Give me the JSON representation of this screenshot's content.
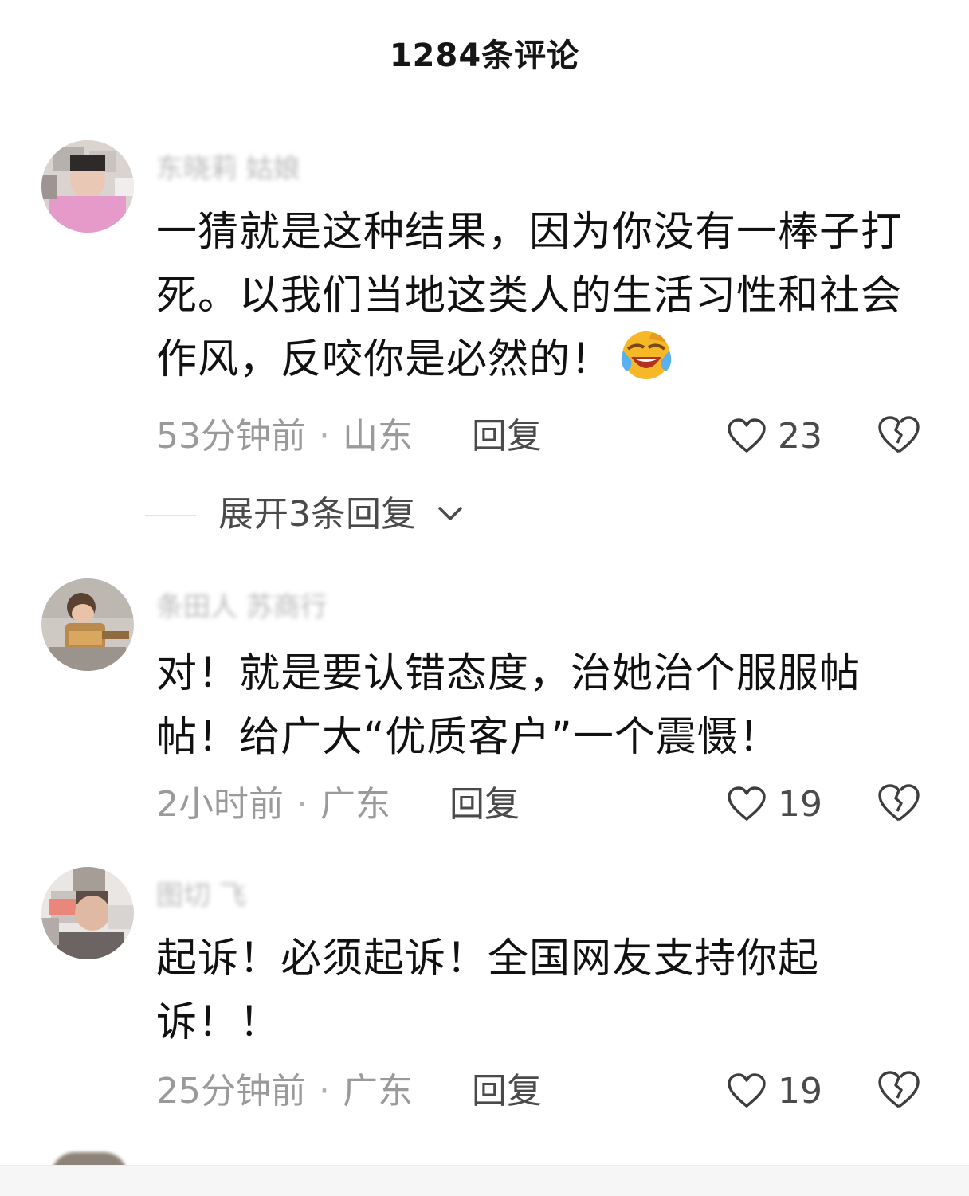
{
  "header": {
    "title": "1284条评论"
  },
  "comments": [
    {
      "username": "东晓莉 姑娘",
      "text": "一猜就是这种结果，因为你没有一棒子打死。以我们当地这类人的生活习性和社会作风，反咬你是必然的！",
      "emoji": "face-with-tears-of-joy",
      "time": "53分钟前",
      "separator": "·",
      "location": "山东",
      "reply": "回复",
      "likes": "23"
    },
    {
      "username": "条田人 苏商行",
      "text": "对！就是要认错态度，治她治个服服帖帖！给广大“优质客户”一个震慑！",
      "time": "2小时前",
      "separator": "·",
      "location": "广东",
      "reply": "回复",
      "likes": "19"
    },
    {
      "username": "图切 飞",
      "text": "起诉！必须起诉！全国网友支持你起诉！！",
      "time": "25分钟前",
      "separator": "·",
      "location": "广东",
      "reply": "回复",
      "likes": "19"
    }
  ],
  "expand_replies": {
    "label": "展开3条回复"
  },
  "colors": {
    "text": "#111111",
    "meta": "#9a9a9a",
    "action": "#4a4a4a"
  }
}
